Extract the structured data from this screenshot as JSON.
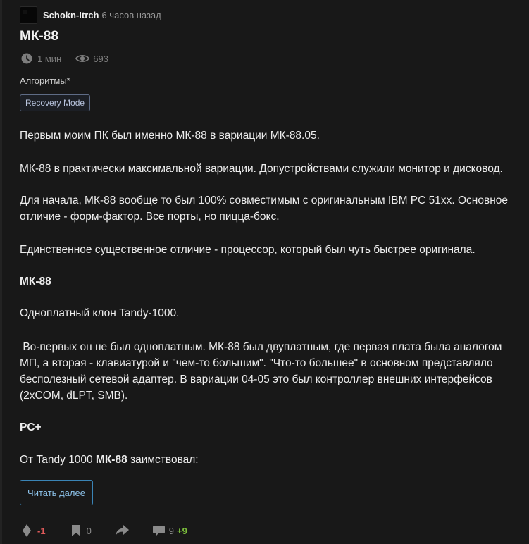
{
  "post": {
    "author": "Schokn-Itrch",
    "time": "6 часов назад",
    "title": "МК-88",
    "reading_time": "1 мин",
    "views": "693",
    "hub": "Алгоритмы*",
    "tag": "Recovery Mode",
    "body": {
      "p1": "Первым моим ПК был именно МК-88 в вариации МК-88.05.",
      "p2": "МК-88 в практически максимальной вариации. Допустройствами служили монитор и дисковод.",
      "p3": "Для начала, МК-88 вообще то был 100% совместимым с оригинальным IBM PC 51xx. Основное отличие - форм-фактор. Все порты, но пицца-бокс.",
      "p4": "Единственное существенное отличие - процессор, который был чуть быстрее оригинала.",
      "h1": "МК-88",
      "p5": "Одноплатный клон Tandy-1000.",
      "p6": " Во-первых он не был одноплатным. МК-88 был двуплатным, где первая плата была аналогом МП, а вторая - клавиатурой и \"чем-то большим\". \"Что-то большее\" в основном представляло бесполезный сетевой адаптер. В вариации 04-05 это был контроллер внешних интерфейсов (2xCOM, dLPT, SMB).",
      "h2": "PC+",
      "p7_prefix": "От Tandy 1000 ",
      "p7_bold": "МК-88",
      "p7_suffix": " заимствовал:"
    },
    "read_more": "Читать далее",
    "footer": {
      "rating": "-1",
      "bookmarks": "0",
      "comments": "9",
      "new_comments": "+9"
    }
  },
  "icons": {
    "clock": "clock-icon",
    "eye": "eye-icon",
    "rating": "rating-icon",
    "bookmark": "bookmark-icon",
    "share": "share-icon",
    "comment": "comment-icon"
  },
  "colors": {
    "background": "#181818",
    "text": "#ececec",
    "muted": "#8a8a8a",
    "negative": "#e05a5a",
    "positive": "#7cbf3c",
    "link_border": "#3a84b6"
  }
}
